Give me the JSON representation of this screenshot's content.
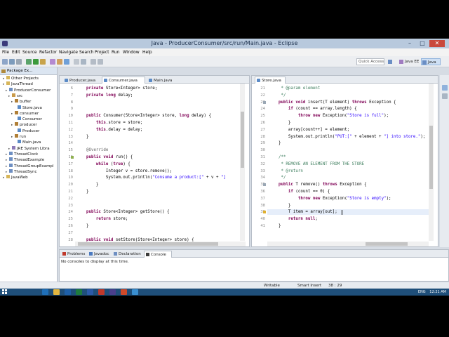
{
  "window": {
    "title": "Java - ProducerConsumer/src/run/Main.java - Eclipse"
  },
  "menu": [
    "File",
    "Edit",
    "Source",
    "Refactor",
    "Navigate",
    "Search",
    "Project",
    "Run",
    "Window",
    "Help"
  ],
  "toolbar": {
    "quick_access": "Quick Access",
    "perspectives": [
      "Java EE",
      "Java"
    ]
  },
  "package_explorer": {
    "tab_label": "Package Ex...",
    "tree": [
      {
        "label": "Other Projects",
        "depth": 1,
        "icon": "folder-icon"
      },
      {
        "label": "JavaThread",
        "depth": 1,
        "icon": "folder-icon"
      },
      {
        "label": "ProducerConsumer",
        "depth": 2,
        "icon": "project-icon"
      },
      {
        "label": "src",
        "depth": 3,
        "icon": "source-folder-icon"
      },
      {
        "label": "buffer",
        "depth": 4,
        "icon": "package-icon"
      },
      {
        "label": "Store.java",
        "depth": 5,
        "icon": "java-file-icon"
      },
      {
        "label": "consumer",
        "depth": 4,
        "icon": "package-icon"
      },
      {
        "label": "Consumer",
        "depth": 5,
        "icon": "java-file-icon"
      },
      {
        "label": "producer",
        "depth": 4,
        "icon": "package-icon"
      },
      {
        "label": "Producer",
        "depth": 5,
        "icon": "java-file-icon"
      },
      {
        "label": "run",
        "depth": 4,
        "icon": "package-icon"
      },
      {
        "label": "Main.java",
        "depth": 5,
        "icon": "java-file-icon"
      },
      {
        "label": "JRE System Libra",
        "depth": 3,
        "icon": "library-icon"
      },
      {
        "label": "ThreadClock",
        "depth": 2,
        "icon": "project-icon"
      },
      {
        "label": "ThreadExample",
        "depth": 2,
        "icon": "project-icon"
      },
      {
        "label": "ThreadGroupExampl",
        "depth": 2,
        "icon": "project-icon"
      },
      {
        "label": "ThreadSync",
        "depth": 2,
        "icon": "project-icon"
      },
      {
        "label": "JavaWeb",
        "depth": 1,
        "icon": "folder-icon"
      }
    ]
  },
  "left_editor": {
    "tabs": [
      {
        "label": "Producer.java",
        "active": false
      },
      {
        "label": "Consumer.java",
        "active": true
      },
      {
        "label": "Main.java",
        "active": false
      }
    ],
    "lines": [
      {
        "n": "6",
        "text": "    private Store<Integer> store;"
      },
      {
        "n": "7",
        "text": "    private long delay;"
      },
      {
        "n": "8",
        "text": ""
      },
      {
        "n": "9",
        "text": ""
      },
      {
        "n": "10",
        "text": "    public Consumer(Store<Integer> store, long delay) {"
      },
      {
        "n": "11",
        "text": "        this.store = store;"
      },
      {
        "n": "12",
        "text": "        this.delay = delay;"
      },
      {
        "n": "13",
        "text": "    }"
      },
      {
        "n": "14",
        "text": ""
      },
      {
        "n": "15",
        "text": "    @Override"
      },
      {
        "n": "16",
        "text": "    public void run() {"
      },
      {
        "n": "17",
        "text": "        while (true) {"
      },
      {
        "n": "18",
        "text": "            Integer v = store.remove();"
      },
      {
        "n": "19",
        "text": "            System.out.println(\"Consume a product:[\" + v + \"]"
      },
      {
        "n": "20",
        "text": "        }"
      },
      {
        "n": "21",
        "text": "    }"
      },
      {
        "n": "22",
        "text": ""
      },
      {
        "n": "23",
        "text": ""
      },
      {
        "n": "24",
        "text": "    public Store<Integer> getStore() {"
      },
      {
        "n": "25",
        "text": "        return store;"
      },
      {
        "n": "26",
        "text": "    }"
      },
      {
        "n": "27",
        "text": ""
      },
      {
        "n": "28",
        "text": "    public void setStore(Store<Integer> store) {"
      }
    ]
  },
  "right_editor": {
    "tabs": [
      {
        "label": "Store.java",
        "active": true
      }
    ],
    "lines": [
      {
        "n": "21",
        "text": "     * @param element"
      },
      {
        "n": "22",
        "text": "     */"
      },
      {
        "n": "23",
        "text": "    public void insert(T element) throws Exception {"
      },
      {
        "n": "24",
        "text": "        if (count == array.length) {"
      },
      {
        "n": "25",
        "text": "            throw new Exception(\"Store is full\");"
      },
      {
        "n": "26",
        "text": "        }"
      },
      {
        "n": "27",
        "text": "        array[count++] = element;"
      },
      {
        "n": "28",
        "text": "        System.out.println(\"PUT:[\" + element + \"] into store.\");"
      },
      {
        "n": "29",
        "text": "    }"
      },
      {
        "n": "30",
        "text": ""
      },
      {
        "n": "31",
        "text": "    /**"
      },
      {
        "n": "32",
        "text": "     * REMOVE AN ELEMENT FROM THE STORE"
      },
      {
        "n": "33",
        "text": "     * @return"
      },
      {
        "n": "34",
        "text": "     */"
      },
      {
        "n": "35",
        "text": "    public T remove() throws Exception {"
      },
      {
        "n": "36",
        "text": "        if (count == 0) {"
      },
      {
        "n": "37",
        "text": "            throw new Exception(\"Store is empty\");"
      },
      {
        "n": "38",
        "text": "        }"
      },
      {
        "n": "39",
        "text": "        T item = array[out];"
      },
      {
        "n": "40",
        "text": "        return null;"
      },
      {
        "n": "41",
        "text": "    }"
      }
    ]
  },
  "bottom_panel": {
    "tabs": [
      {
        "label": "Problems",
        "active": false
      },
      {
        "label": "Javadoc",
        "active": false
      },
      {
        "label": "Declaration",
        "active": false
      },
      {
        "label": "Console",
        "active": true
      }
    ],
    "message": "No consoles to display at this time."
  },
  "status_bar": {
    "mode": "Writable",
    "insert": "Smart Insert",
    "position": "38 : 29"
  },
  "taskbar": {
    "language": "ENG",
    "time": "12:21 AM"
  },
  "colors": {
    "keyword": "#7f0055",
    "string": "#2a00ff",
    "comment": "#3f7f5f",
    "field": "#0000c0",
    "annotation": "#646464",
    "titlebar": "#b8c9dd",
    "taskbar": "#1f4f7a"
  }
}
